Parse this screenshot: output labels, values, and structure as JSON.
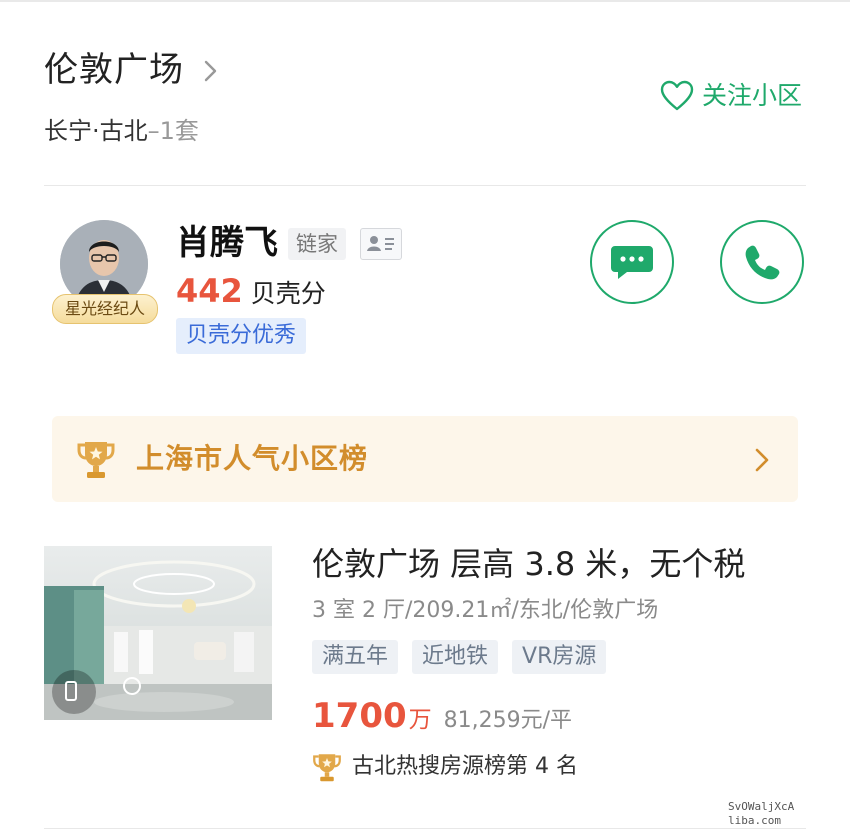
{
  "community": {
    "name": "伦敦广场",
    "district": "长宁·古北",
    "listing_count": "–1套",
    "follow_label": "关注小区"
  },
  "agent": {
    "name": "肖腾飞",
    "agency": "链家",
    "badge": "星光经纪人",
    "score_value": "442",
    "score_unit": "贝壳分",
    "score_level": "贝壳分优秀"
  },
  "ranking_banner": {
    "label": "上海市人气小区榜"
  },
  "listing": {
    "title": "伦敦广场 层高 3.8 米，无个税",
    "meta": "3 室 2 厅/209.21㎡/东北/伦敦广场",
    "tags": [
      "满五年",
      "近地铁",
      "VR房源"
    ],
    "price_value": "1700",
    "price_unit": "万",
    "unit_price": "81,259元/平",
    "hot_rank": "古北热搜房源榜第 4 名"
  },
  "watermark": {
    "line1": "SvOWaljXcA",
    "line2": "liba.com"
  },
  "colors": {
    "accent_green": "#1fa96b",
    "price_red": "#e8553d",
    "gold": "#d28d2c",
    "score_blue": "#3a6bd8"
  },
  "icons": {
    "title_chevron": "chevron-right-icon",
    "follow": "heart-icon",
    "agent_card": "business-card-icon",
    "message": "chat-bubble-icon",
    "call": "phone-icon",
    "trophy": "trophy-icon",
    "banner_chevron": "chevron-right-icon",
    "vr": "vr-icon"
  }
}
